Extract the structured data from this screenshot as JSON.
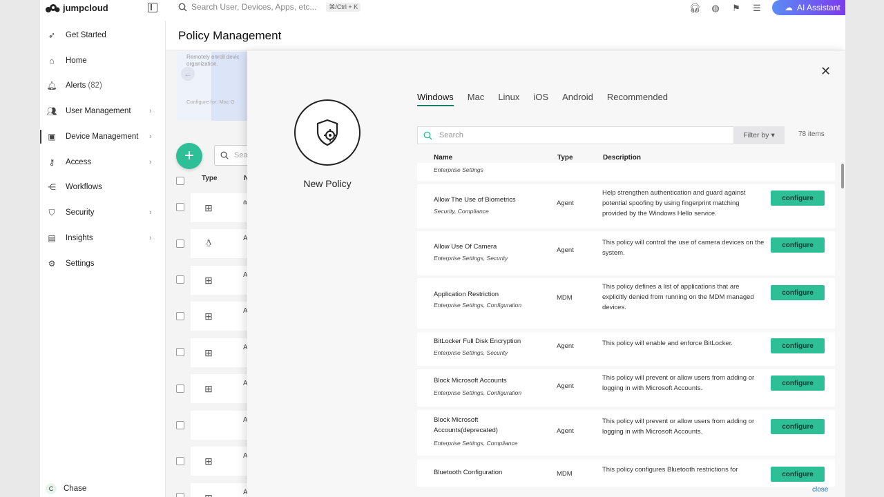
{
  "topbar": {
    "brand": "jumpcloud",
    "search_placeholder": "Search User, Devices, Apps, etc...",
    "shortcut": "⌘/Ctrl + K",
    "ai_button": "AI Assistant"
  },
  "sidebar": {
    "items": [
      {
        "label": "Get Started",
        "icon": "rocket-icon"
      },
      {
        "label": "Home",
        "icon": "home-icon"
      },
      {
        "label": "Alerts",
        "count": "(82)",
        "icon": "bell-icon"
      },
      {
        "label": "User Management",
        "icon": "users-icon"
      },
      {
        "label": "Device Management",
        "icon": "devices-icon"
      },
      {
        "label": "Access",
        "icon": "key-icon"
      },
      {
        "label": "Workflows",
        "icon": "workflow-icon"
      },
      {
        "label": "Security",
        "icon": "shield-icon"
      },
      {
        "label": "Insights",
        "icon": "chart-icon"
      },
      {
        "label": "Settings",
        "icon": "gear-icon"
      }
    ],
    "user_initial": "C",
    "user_name": "Chase"
  },
  "page": {
    "title": "Policy Management",
    "banner_text": "Remotely enroll devic organization.",
    "banner_configure": "Configure for: Mac O",
    "list_search_placeholder": "Sear",
    "col_type": "Type",
    "col_name": "N"
  },
  "modal": {
    "heading": "New Policy",
    "tabs": [
      "Windows",
      "Mac",
      "Linux",
      "iOS",
      "Android",
      "Recommended"
    ],
    "search_placeholder": "Search",
    "filter_label": "Filter by",
    "items_count": "78 items",
    "columns": {
      "name": "Name",
      "type": "Type",
      "description": "Description"
    },
    "partial_category": "Enterprise Settings",
    "configure_label": "configure",
    "close_label": "close",
    "policies": [
      {
        "name": "Allow The Use of Biometrics",
        "category": "Security, Compliance",
        "type": "Agent",
        "description": "Help strengthen authentication and guard against potential spoofing by using fingerprint matching provided by the Windows Hello service."
      },
      {
        "name": "Allow Use Of Camera",
        "category": "Enterprise Settings, Security",
        "type": "Agent",
        "description": "This policy will control the use of camera devices on the system."
      },
      {
        "name": "Application Restriction",
        "category": "Enterprise Settings, Configuration",
        "type": "MDM",
        "description": "This policy defines a list of applications that are explicitly denied from running on the MDM managed devices."
      },
      {
        "name": "BitLocker Full Disk Encryption",
        "category": "Enterprise Settings, Security",
        "type": "Agent",
        "description": "This policy will enable and enforce BitLocker."
      },
      {
        "name": "Block Microsoft Accounts",
        "category": "Enterprise Settings, Configuration",
        "type": "Agent",
        "description": "This policy will prevent or allow users from adding or logging in with Microsoft Accounts."
      },
      {
        "name": "Block Microsoft Accounts(deprecated)",
        "category": "Enterprise Settings, Compliance",
        "type": "Agent",
        "description": "This policy will prevent or allow users from adding or logging in with Microsoft Accounts."
      },
      {
        "name": "Bluetooth Configuration",
        "category": "",
        "type": "MDM",
        "description": "This policy configures Bluetooth restrictions for"
      }
    ]
  }
}
